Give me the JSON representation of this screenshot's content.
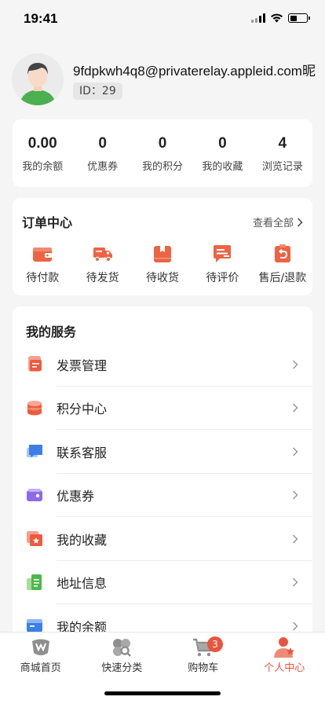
{
  "status_bar": {
    "time": "19:41"
  },
  "profile": {
    "email": "9fdpkwh4q8@privaterelay.appleid.com昵",
    "id_label": "ID：",
    "id_value": "29"
  },
  "stats": [
    {
      "value": "0.00",
      "label": "我的余额"
    },
    {
      "value": "0",
      "label": "优惠券"
    },
    {
      "value": "0",
      "label": "我的积分"
    },
    {
      "value": "0",
      "label": "我的收藏"
    },
    {
      "value": "4",
      "label": "浏览记录"
    }
  ],
  "orders": {
    "title": "订单中心",
    "view_all": "查看全部",
    "items": [
      {
        "label": "待付款",
        "icon": "wallet-icon"
      },
      {
        "label": "待发货",
        "icon": "truck-icon"
      },
      {
        "label": "待收货",
        "icon": "package-icon"
      },
      {
        "label": "待评价",
        "icon": "comment-icon"
      },
      {
        "label": "售后/退款",
        "icon": "return-icon"
      }
    ]
  },
  "services": {
    "title": "我的服务",
    "items": [
      {
        "label": "发票管理",
        "icon": "invoice-icon"
      },
      {
        "label": "积分中心",
        "icon": "coins-icon"
      },
      {
        "label": "联系客服",
        "icon": "chat-icon"
      },
      {
        "label": "优惠券",
        "icon": "coupon-icon"
      },
      {
        "label": "我的收藏",
        "icon": "favorite-icon"
      },
      {
        "label": "地址信息",
        "icon": "address-icon"
      },
      {
        "label": "我的余额",
        "icon": "balance-icon"
      }
    ]
  },
  "tabs": [
    {
      "label": "商城首页",
      "icon": "shop-home-icon",
      "active": false
    },
    {
      "label": "快速分类",
      "icon": "category-icon",
      "active": false
    },
    {
      "label": "购物车",
      "icon": "cart-icon",
      "active": false,
      "badge": "3"
    },
    {
      "label": "个人中心",
      "icon": "user-center-icon",
      "active": true
    }
  ],
  "colors": {
    "accent": "#e8553f",
    "background": "#f5f5f5",
    "card": "#ffffff"
  }
}
